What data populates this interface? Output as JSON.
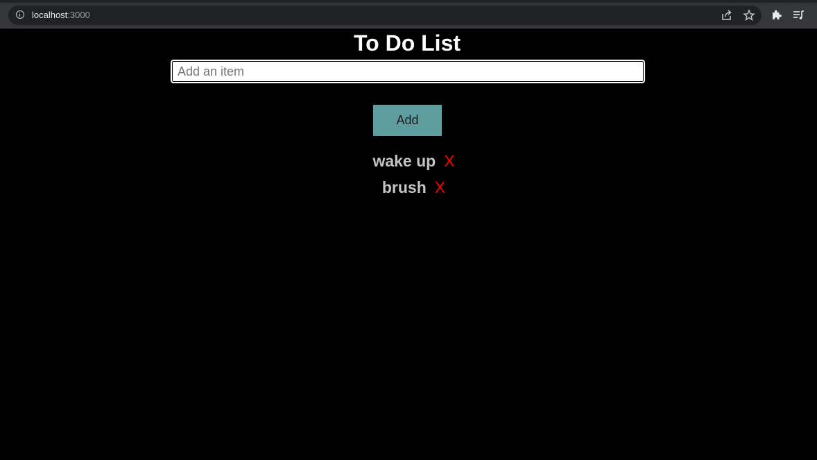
{
  "browser": {
    "url_host": "localhost",
    "url_port": ":3000",
    "icons": [
      "info-icon",
      "share-icon",
      "star-icon",
      "extensions-icon",
      "reading-list-icon"
    ]
  },
  "app": {
    "title": "To Do List",
    "input": {
      "placeholder": "Add an item",
      "value": ""
    },
    "add_button_label": "Add",
    "items": [
      {
        "text": "wake up",
        "delete_label": "X"
      },
      {
        "text": "brush",
        "delete_label": "X"
      }
    ],
    "colors": {
      "background": "#000000",
      "button": "#5f9ea0",
      "delete": "#ff0000",
      "item_text": "#c4c4c4"
    }
  }
}
